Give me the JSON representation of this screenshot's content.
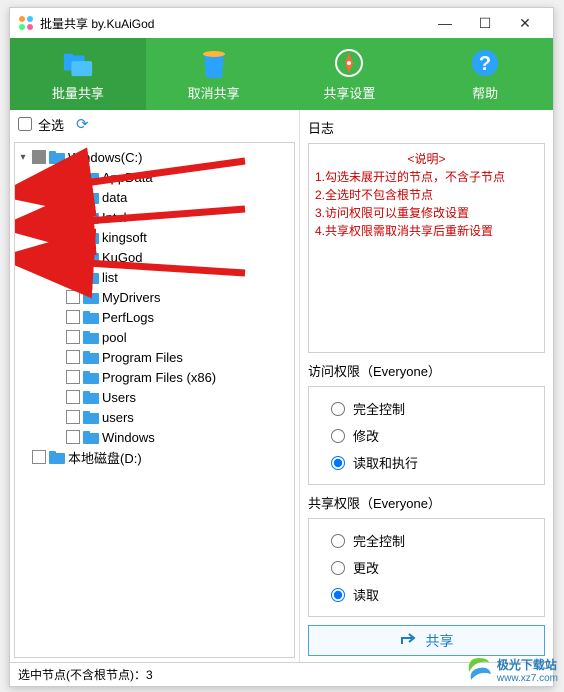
{
  "title": "批量共享 by.KuAiGod",
  "toolbar": {
    "share": "批量共享",
    "unshare": "取消共享",
    "settings": "共享设置",
    "help": "帮助"
  },
  "left": {
    "select_all": "全选"
  },
  "tree": {
    "root": "Windows(C:)",
    "items": [
      {
        "label": "AppData",
        "checked": false,
        "expander": "▶"
      },
      {
        "label": "data",
        "checked": true,
        "expander": "▶"
      },
      {
        "label": "Intel",
        "checked": false,
        "expander": ""
      },
      {
        "label": "kingsoft",
        "checked": true,
        "expander": "▶"
      },
      {
        "label": "KuGod",
        "checked": false,
        "expander": ""
      },
      {
        "label": "list",
        "checked": true,
        "expander": "▶"
      },
      {
        "label": "MyDrivers",
        "checked": false,
        "expander": ""
      },
      {
        "label": "PerfLogs",
        "checked": false,
        "expander": ""
      },
      {
        "label": "pool",
        "checked": false,
        "expander": ""
      },
      {
        "label": "Program Files",
        "checked": false,
        "expander": ""
      },
      {
        "label": "Program Files (x86)",
        "checked": false,
        "expander": ""
      },
      {
        "label": "Users",
        "checked": false,
        "expander": ""
      },
      {
        "label": "users",
        "checked": false,
        "expander": ""
      },
      {
        "label": "Windows",
        "checked": false,
        "expander": ""
      }
    ],
    "disk2": "本地磁盘(D:)"
  },
  "right": {
    "log_label": "日志",
    "log_title": "<说明>",
    "log_lines": [
      "1.勾选未展开过的节点，不含子节点",
      "2.全选时不包含根节点",
      "3.访问权限可以重复修改设置",
      "4.共享权限需取消共享后重新设置"
    ],
    "access_perm_label": "访问权限（Everyone）",
    "access_opts": {
      "full": "完全控制",
      "modify": "修改",
      "read_exec": "读取和执行"
    },
    "share_perm_label": "共享权限（Everyone）",
    "share_opts": {
      "full": "完全控制",
      "change": "更改",
      "read": "读取"
    },
    "share_btn": "共享"
  },
  "status": "选中节点(不含根节点)：3",
  "watermark": {
    "site": "极光下载站",
    "url": "www.xz7.com"
  }
}
